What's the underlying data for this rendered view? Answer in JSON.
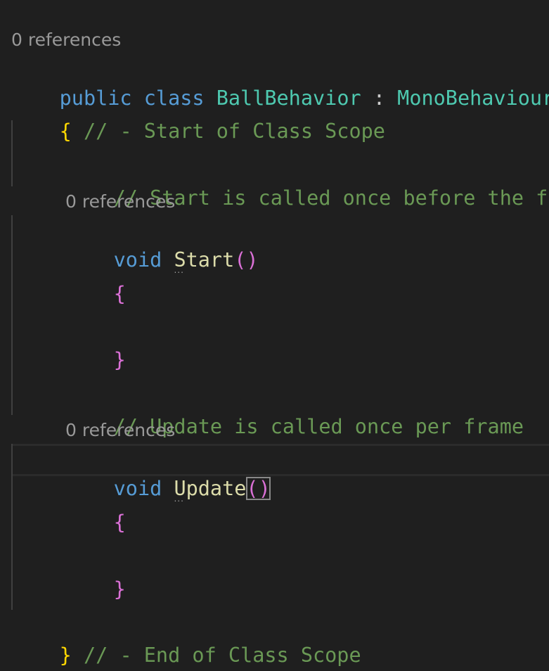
{
  "codelens": {
    "class_refs": "0 references",
    "start_refs": "0 references",
    "update_refs": "0 references"
  },
  "code": {
    "kw_public": "public",
    "kw_class": "class",
    "class_name": "BallBehavior",
    "colon": ":",
    "base_class": "MonoBehaviour",
    "open_brace": "{",
    "class_start_comment": "// - Start of Class Scope",
    "start_comment": "// Start is called once before the first execution of Update after the MonoBehaviour is created",
    "kw_void_start": "void",
    "start_name": "Start",
    "start_parens": "()",
    "start_open": "{",
    "start_close": "}",
    "update_comment": "// Update is called once per frame",
    "kw_void_update": "void",
    "update_name": "Update",
    "update_parens": "()",
    "update_open": "{",
    "update_close": "}",
    "close_brace": "}",
    "class_end_comment": "// - End of Class Scope",
    "hint_dots": "..."
  },
  "colors": {
    "background": "#1f1f1f",
    "keyword": "#569cd6",
    "type": "#4ec9b0",
    "method": "#dcdcaa",
    "comment": "#6a9955",
    "brace_level1": "#ffd700",
    "brace_level2": "#da70d6",
    "codelens": "#999999"
  }
}
